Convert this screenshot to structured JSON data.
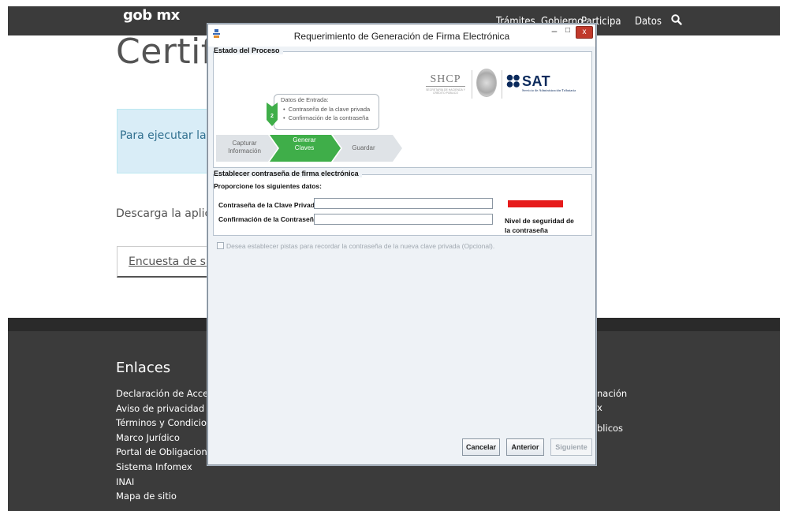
{
  "site": {
    "logo": "gob mx",
    "nav": [
      "Trámites",
      "Gobierno",
      "Participa",
      "Datos"
    ],
    "page_title": "Certificado",
    "alert_text": "Para ejecutar la aplicación",
    "description": "Descarga la aplicación",
    "survey_link": "Encuesta de satisfacción",
    "footer": {
      "heading": "Enlaces",
      "links": [
        "Declaración de Accesibilidad",
        "Aviso de privacidad",
        "Términos y Condiciones",
        "Marco Jurídico",
        "Portal de Obligaciones de Transparencia",
        "Sistema Infomex",
        "INAI",
        "Mapa de sitio"
      ],
      "right_fragments": [
        "nación",
        "x",
        "blicos"
      ]
    }
  },
  "dialog": {
    "title": "Requerimiento de Generación de Firma Electrónica",
    "minimize": "–",
    "maximize": "□",
    "close": "x",
    "process_group": {
      "legend": "Estado del Proceso",
      "shcp": {
        "title": "SHCP",
        "subtitle": "SECRETARÍA DE HACIENDA Y CRÉDITO PÚBLICO"
      },
      "sat": {
        "title": "SAT",
        "subtitle": "Servicio de Administración Tributaria"
      },
      "input_box": {
        "title": "Datos de Entrada:",
        "items": [
          "Contraseña de la clave privada",
          "Confirmación de la contraseña"
        ]
      },
      "current_step_number": "2",
      "steps": [
        {
          "line1": "Capturar",
          "line2": "Información"
        },
        {
          "line1": "Generar",
          "line2": "Claves"
        },
        {
          "line1": "Guardar",
          "line2": ""
        }
      ]
    },
    "password_group": {
      "legend": "Establecer contraseña de firma electrónica",
      "instructions": "Proporcione los siguientes datos:",
      "private_key_label": "Contraseña de la Clave Privada",
      "private_key_value": "",
      "confirm_label": "Confirmación de la Contraseña",
      "confirm_value": "",
      "security_label_line1": "Nivel de seguridad de",
      "security_label_line2": "la contraseña",
      "security_color": "#e61b1b"
    },
    "hints_checkbox": {
      "label": "Desea establecer pistas para recordar la contraseña de la nueva clave privada (Opcional).",
      "checked": false,
      "enabled": false
    },
    "buttons": {
      "cancel": "Cancelar",
      "previous": "Anterior",
      "next": "Siguiente"
    }
  }
}
